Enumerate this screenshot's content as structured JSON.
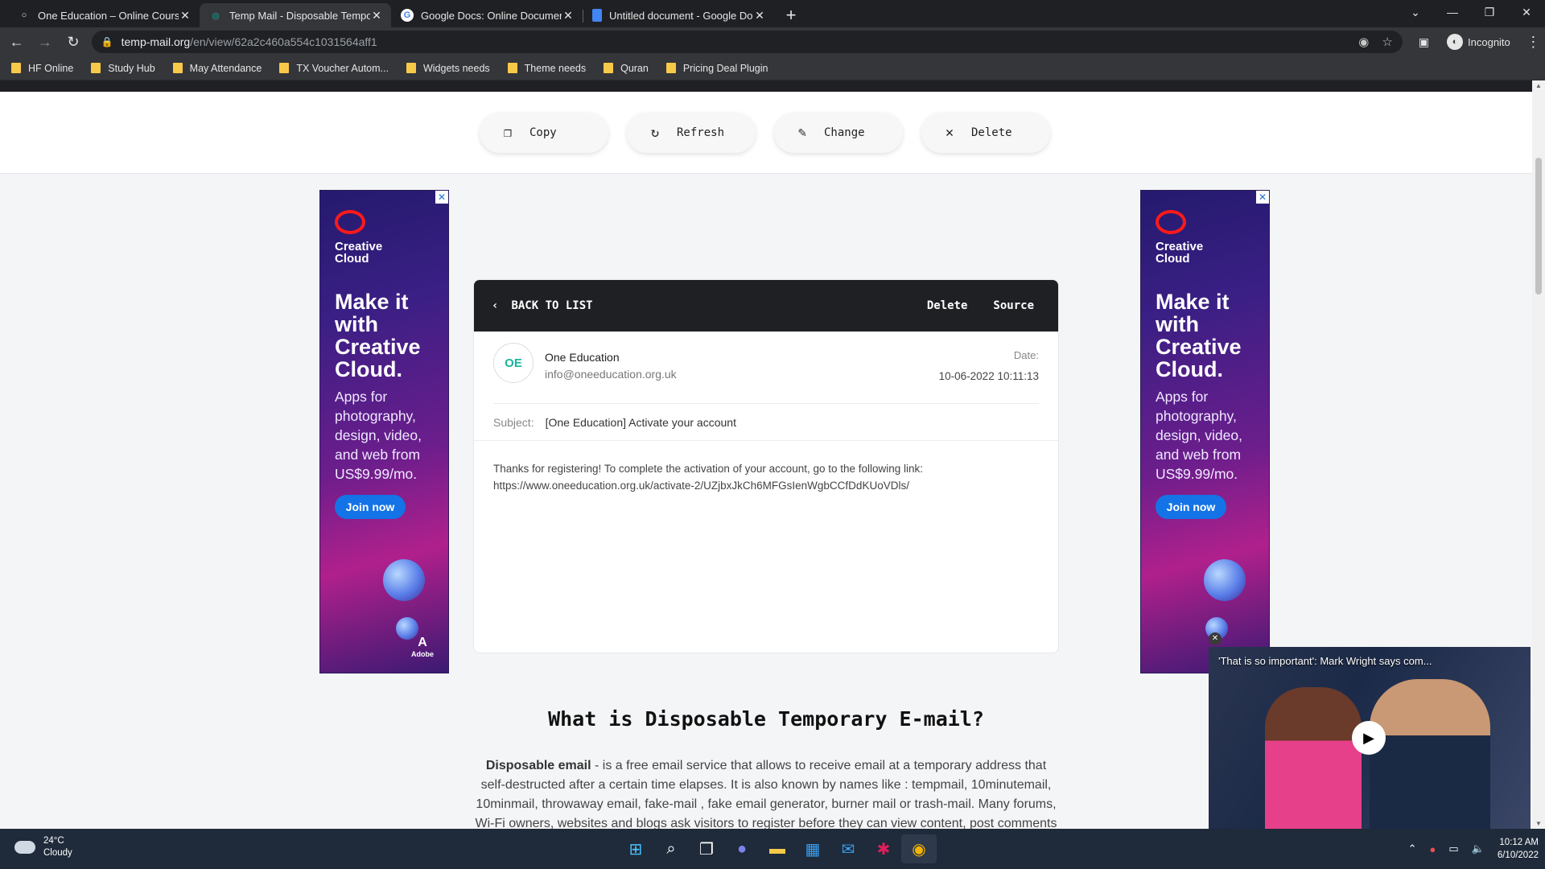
{
  "browser": {
    "tabs": [
      {
        "title": "One Education – Online Courses",
        "active": false
      },
      {
        "title": "Temp Mail - Disposable Tempora",
        "active": true
      },
      {
        "title": "Google Docs: Online Document E",
        "active": false
      },
      {
        "title": "Untitled document - Google Doc",
        "active": false
      }
    ],
    "url_host": "temp-mail.org",
    "url_path": "/en/view/62a2c460a554c1031564aff1",
    "profile_label": "Incognito",
    "bookmarks": [
      "HF Online",
      "Study Hub",
      "May Attendance",
      "TX Voucher Autom...",
      "Widgets needs",
      "Theme needs",
      "Quran",
      "Pricing Deal Plugin"
    ]
  },
  "actions": {
    "copy": "Copy",
    "refresh": "Refresh",
    "change": "Change",
    "delete": "Delete"
  },
  "ad": {
    "brand_line1": "Creative",
    "brand_line2": "Cloud",
    "headline": "Make it with Creative Cloud.",
    "subtext": "Apps for photography, design, video, and web from US$9.99/mo.",
    "cta": "Join now",
    "adobe_label": "Adobe"
  },
  "email": {
    "back_label": "BACK TO LIST",
    "delete_label": "Delete",
    "source_label": "Source",
    "avatar_initials": "OE",
    "sender_name": "One Education",
    "sender_email": "info@oneeducation.org.uk",
    "date_label": "Date:",
    "date_value": "10-06-2022 10:11:13",
    "subject_label": "Subject:",
    "subject_value": "[One Education] Activate your account",
    "body_line1": "Thanks for registering! To complete the activation of your account, go to the following link:",
    "body_link": "https://www.oneeducation.org.uk/activate-2/UZjbxJkCh6MFGsIenWgbCCfDdKUoVDls/"
  },
  "info": {
    "heading": "What is Disposable Temporary E-mail?",
    "lead_bold": "Disposable email",
    "paragraph": " - is a free email service that allows to receive email at a temporary address that self-destructed after a certain time elapses. It is also known by names like : tempmail, 10minutemail, 10minmail, throwaway email, fake-mail , fake email generator, burner mail or trash-mail. Many forums, Wi-Fi owners, websites and blogs ask visitors to register before they can view content, post comments"
  },
  "video": {
    "title": "'That is so important': Mark Wright says com..."
  },
  "taskbar": {
    "temperature": "24°C",
    "condition": "Cloudy",
    "time": "10:12 AM",
    "date": "6/10/2022"
  },
  "colors": {
    "accent_teal": "#18b49a",
    "card_header": "#1f2024",
    "ad_cta": "#1473e6"
  }
}
